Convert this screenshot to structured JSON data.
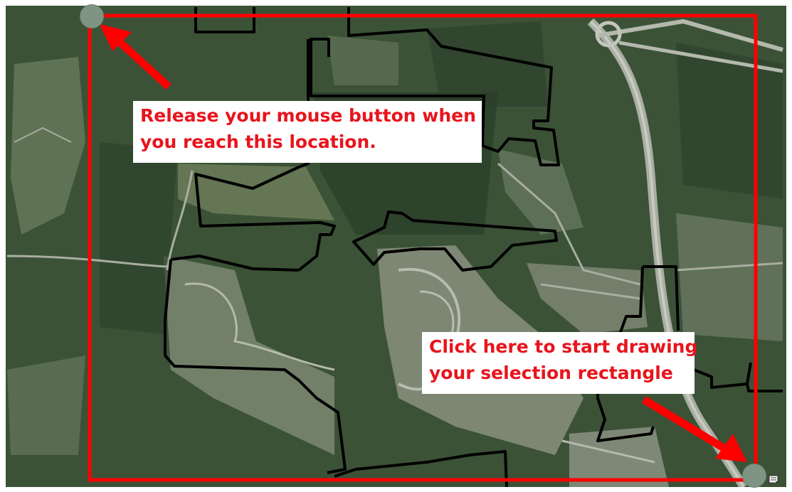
{
  "callouts": {
    "release": {
      "line1": "Release your mouse button when",
      "line2": "you reach this location."
    },
    "start": {
      "line1": "Click here to start drawing",
      "line2": "your selection rectangle"
    }
  },
  "colors": {
    "selection_rectangle": "#ff0000",
    "callout_text": "#e8141c",
    "parcel_outline": "#000000",
    "handle": "#7f9482",
    "imagery_base": "#3b5237"
  },
  "icons": {
    "corner": "layer-icon"
  }
}
